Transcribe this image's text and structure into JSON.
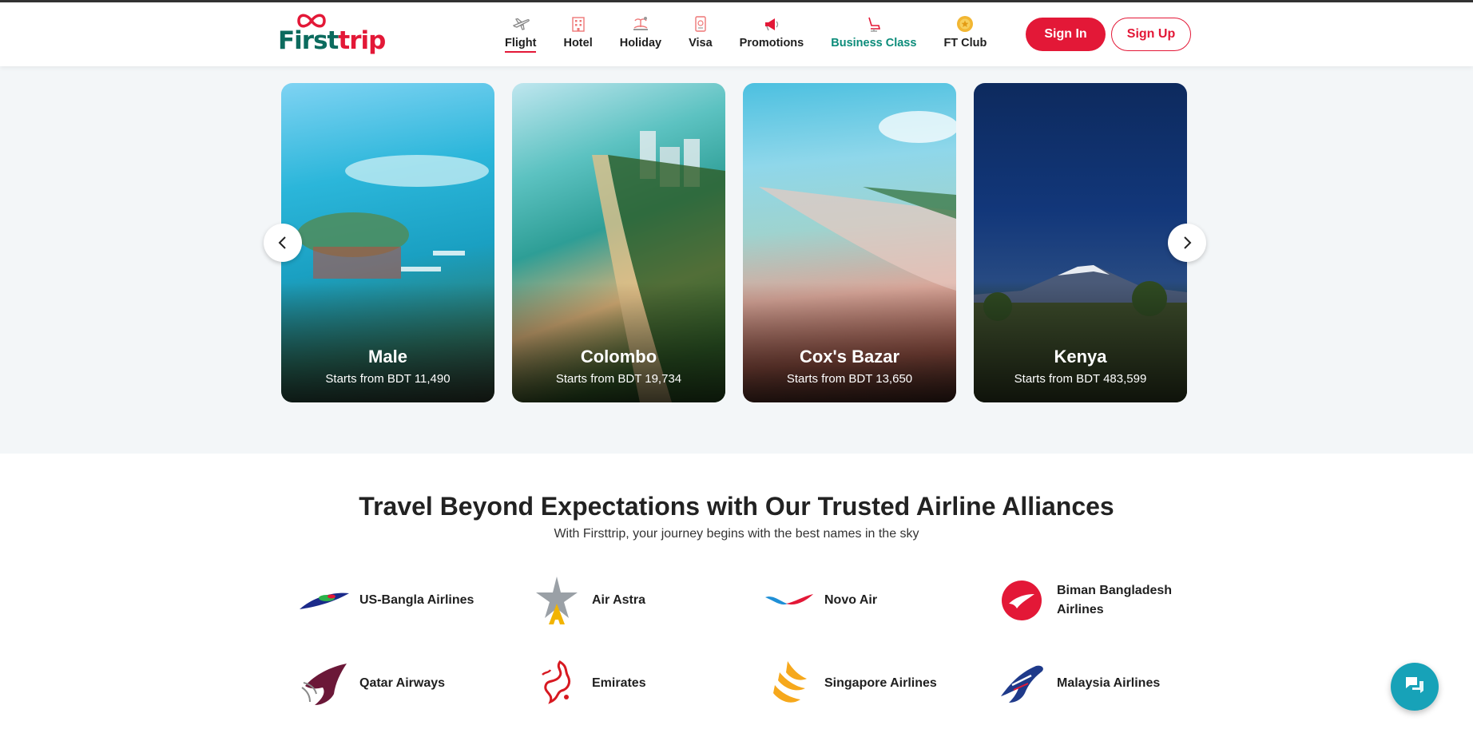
{
  "brand": {
    "name_first": "First",
    "name_trip": "trip",
    "colors": {
      "primary": "#e31837",
      "secondary": "#0c6b5e",
      "business": "#0c8c7a",
      "chat": "#17a2b8"
    }
  },
  "nav": {
    "items": [
      {
        "label": "Flight",
        "icon": "airplane-icon",
        "active": true
      },
      {
        "label": "Hotel",
        "icon": "hotel-icon"
      },
      {
        "label": "Holiday",
        "icon": "holiday-icon"
      },
      {
        "label": "Visa",
        "icon": "passport-icon"
      },
      {
        "label": "Promotions",
        "icon": "megaphone-icon"
      },
      {
        "label": "Business Class",
        "icon": "seat-icon"
      },
      {
        "label": "FT Club",
        "icon": "medal-icon"
      }
    ]
  },
  "auth": {
    "signin_label": "Sign In",
    "signup_label": "Sign Up"
  },
  "destinations": [
    {
      "city": "Male",
      "price": "Starts from BDT 11,490"
    },
    {
      "city": "Colombo",
      "price": "Starts from BDT 19,734"
    },
    {
      "city": "Cox's Bazar",
      "price": "Starts from BDT 13,650"
    },
    {
      "city": "Kenya",
      "price": "Starts from BDT 483,599"
    }
  ],
  "alliances": {
    "title": "Travel Beyond Expectations with Our Trusted Airline Alliances",
    "subtitle": "With Firsttrip, your journey begins with the best names in the sky",
    "airlines": [
      {
        "name": "US-Bangla Airlines"
      },
      {
        "name": "Air Astra"
      },
      {
        "name": "Novo Air"
      },
      {
        "name": "Biman Bangladesh Airlines"
      },
      {
        "name": "Qatar Airways"
      },
      {
        "name": "Emirates"
      },
      {
        "name": "Singapore Airlines"
      },
      {
        "name": "Malaysia Airlines"
      }
    ]
  }
}
